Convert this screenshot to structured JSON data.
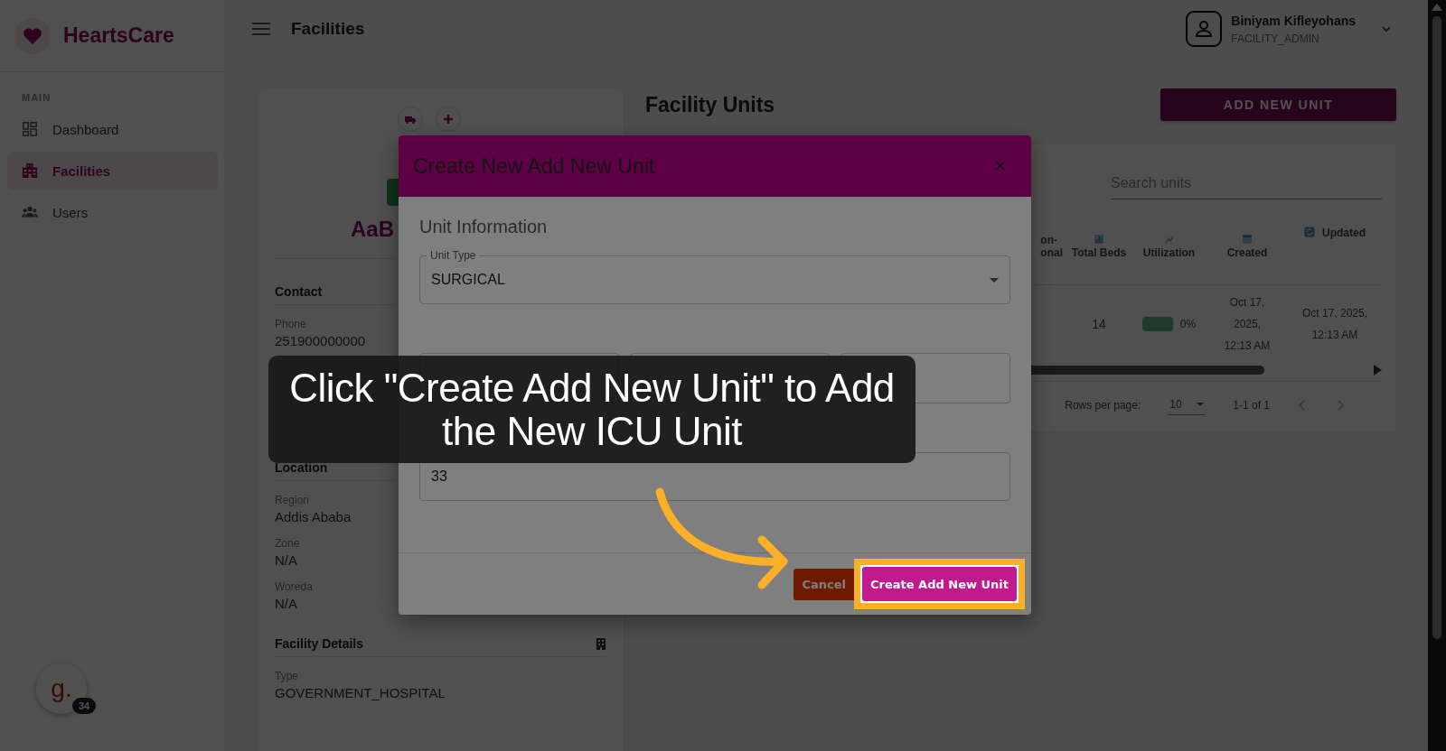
{
  "sidebar": {
    "brand": "HeartsCare",
    "section_label": "MAIN",
    "items": [
      {
        "label": "Dashboard",
        "selected": false
      },
      {
        "label": "Facilities",
        "selected": true
      },
      {
        "label": "Users",
        "selected": false
      }
    ]
  },
  "header": {
    "title": "Facilities",
    "user": {
      "name": "Biniyam Kifleyohans",
      "role": "FACILITY_ADMIN"
    }
  },
  "facility_card": {
    "name": "AaB",
    "sections": [
      {
        "title": "Contact",
        "fields": [
          {
            "label": "Phone",
            "value": "251900000000"
          }
        ]
      },
      {
        "title": "Location",
        "fields": [
          {
            "label": "Region",
            "value": "Addis Ababa"
          },
          {
            "label": "Zone",
            "value": "N/A"
          },
          {
            "label": "Woreda",
            "value": "N/A"
          }
        ]
      },
      {
        "title": "Facility Details",
        "fields": [
          {
            "label": "Type",
            "value": "GOVERNMENT_HOSPITAL"
          }
        ]
      }
    ]
  },
  "units": {
    "title": "Facility Units",
    "add_button": "ADD NEW UNIT",
    "search": {
      "placeholder": "Search units"
    },
    "columns": [
      {
        "label": "on- onal"
      },
      {
        "label": "Total Beds"
      },
      {
        "label": "Utilization"
      },
      {
        "label": "Created"
      },
      {
        "label": "Updated"
      }
    ],
    "rows": [
      {
        "total_beds": "14",
        "utilization": "0%",
        "created": "Oct 17, 2025, 12:13 AM",
        "updated": "Oct 17, 2025, 12:13 AM"
      }
    ],
    "pagination": {
      "rows_per_page_label": "Rows per page:",
      "rows_per_page": "10",
      "range": "1-1 of 1"
    }
  },
  "modal": {
    "title": "Create New Add New Unit",
    "close": "×",
    "section": "Unit Information",
    "unit_type": {
      "label": "Unit Type",
      "value": "SURGICAL"
    },
    "available": {
      "value": "33"
    },
    "cancel": "Cancel",
    "submit": "Create Add New Unit"
  },
  "tutorial": {
    "caption": "Click \"Create Add New Unit\" to Add the New ICU Unit"
  },
  "widget": {
    "logo": "g.",
    "badge": "34"
  }
}
